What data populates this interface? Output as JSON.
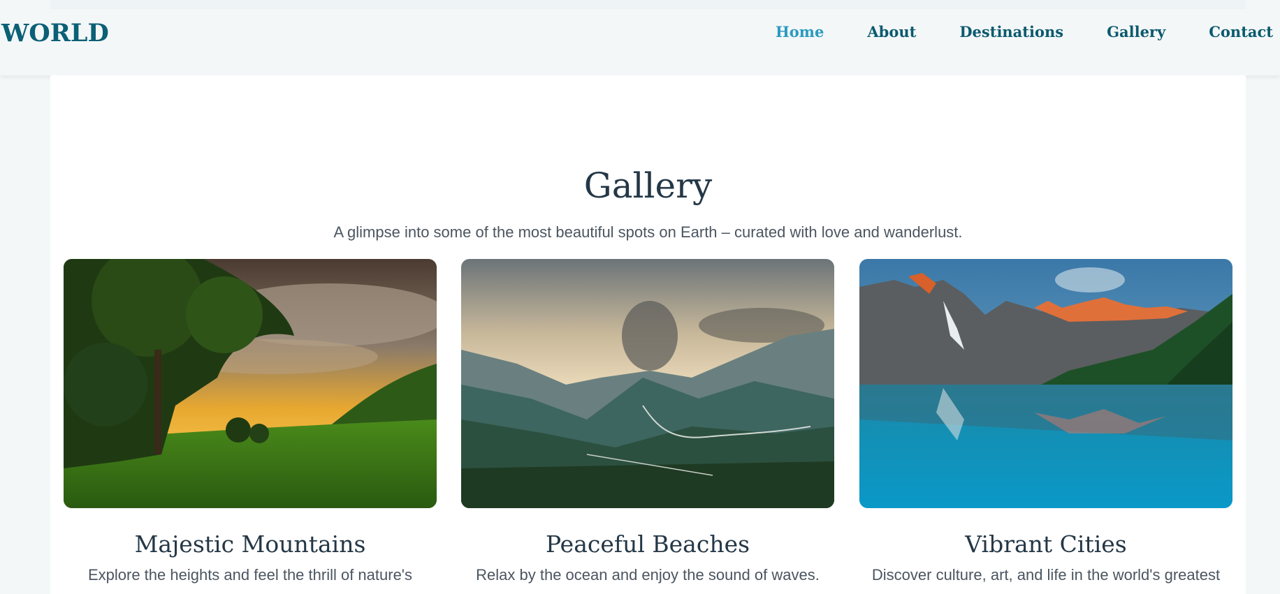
{
  "brand": {
    "logo": "WORLD"
  },
  "nav": {
    "items": [
      {
        "label": "Home",
        "active": true
      },
      {
        "label": "About",
        "active": false
      },
      {
        "label": "Destinations",
        "active": false
      },
      {
        "label": "Gallery",
        "active": false
      },
      {
        "label": "Contact",
        "active": false
      }
    ]
  },
  "gallery": {
    "title": "Gallery",
    "subtitle": "A glimpse into some of the most beautiful spots on Earth – curated with love and wanderlust.",
    "cards": [
      {
        "title": "Majestic Mountains",
        "description": "Explore the heights and feel the thrill of nature's"
      },
      {
        "title": "Peaceful Beaches",
        "description": "Relax by the ocean and enjoy the sound of waves."
      },
      {
        "title": "Vibrant Cities",
        "description": "Discover culture, art, and life in the world's greatest"
      }
    ]
  },
  "colors": {
    "brand": "#0b6075",
    "nav_active": "#2b9bc0",
    "heading": "#243746",
    "body_text": "#4b5560"
  }
}
